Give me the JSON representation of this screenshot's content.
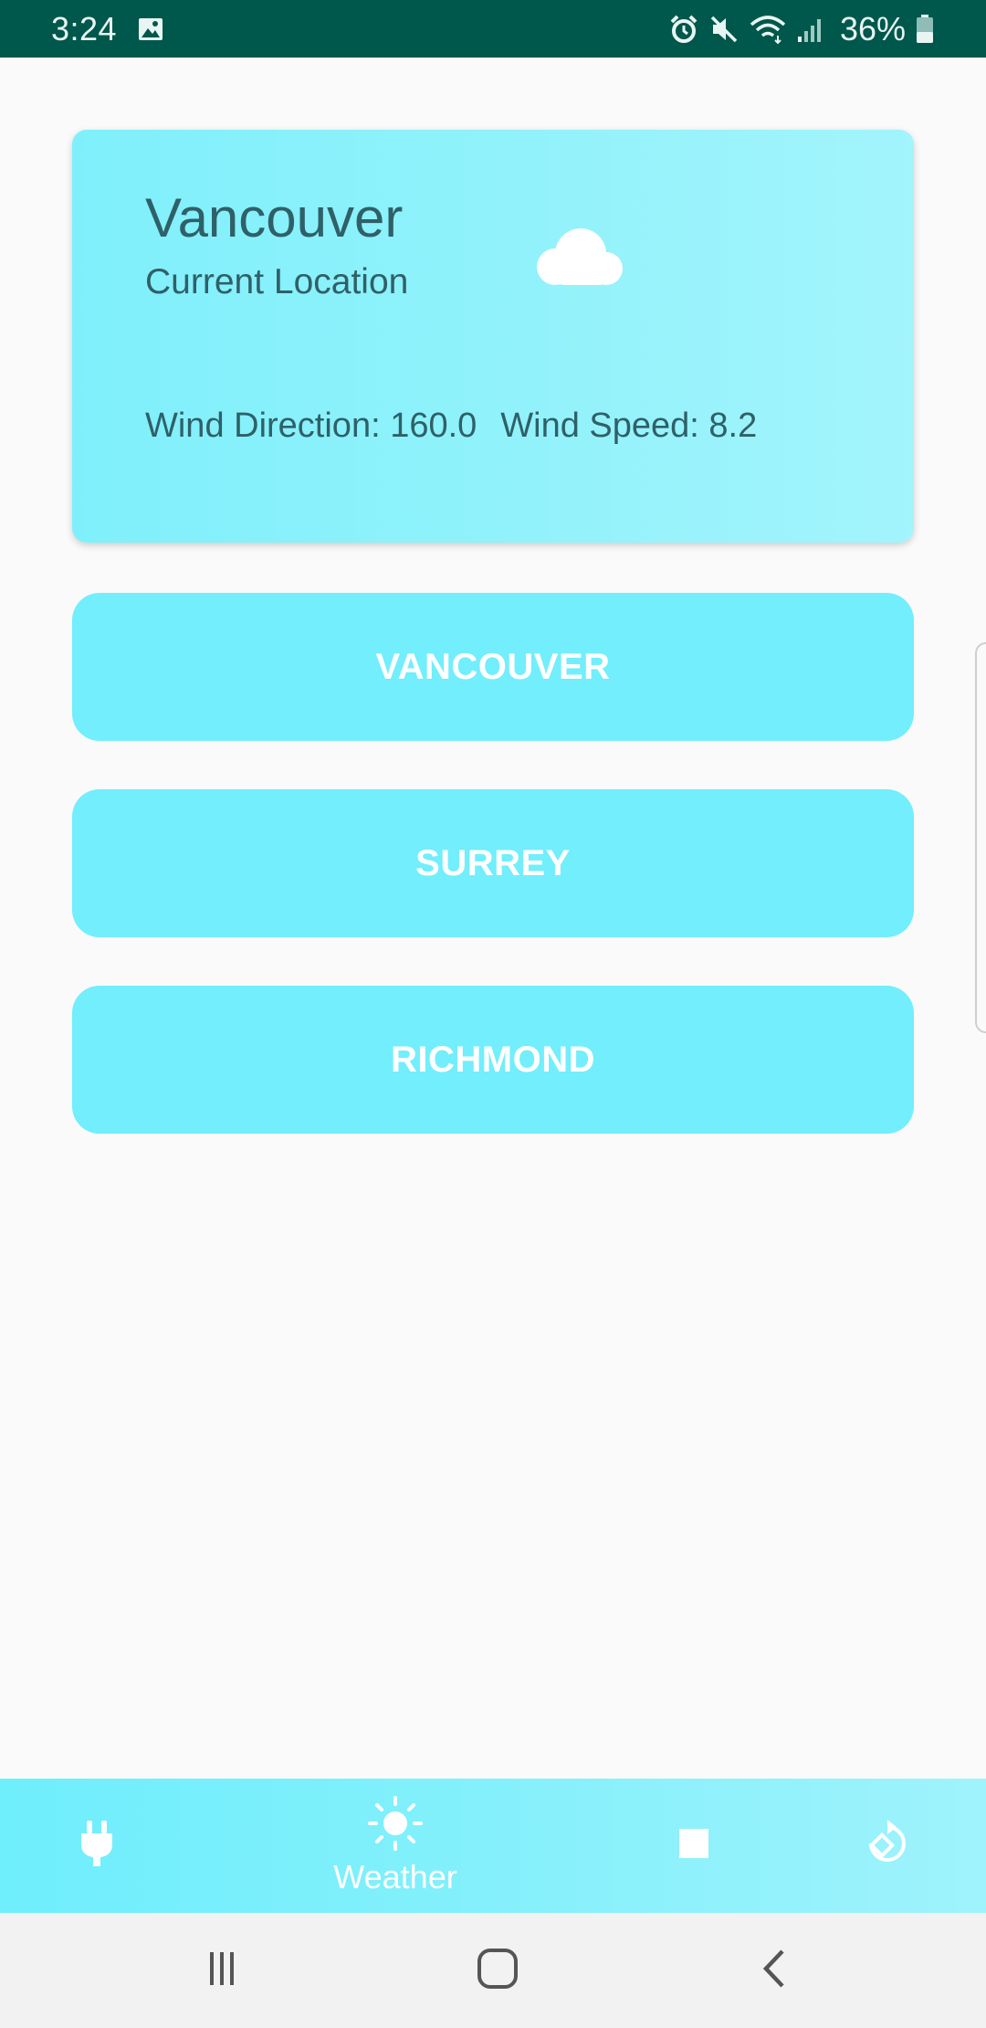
{
  "status_bar": {
    "time": "3:24",
    "battery": "36%",
    "background": "#00574b"
  },
  "weather_card": {
    "city": "Vancouver",
    "location_label": "Current Location",
    "condition_icon": "cloud-icon",
    "wind_direction": "Wind Direction: 160.0",
    "wind_speed": "Wind Speed: 8.2"
  },
  "city_buttons": [
    {
      "label": "VANCOUVER"
    },
    {
      "label": "SURREY"
    },
    {
      "label": "RICHMOND"
    }
  ],
  "bottom_nav": {
    "items": [
      {
        "icon": "plug-icon",
        "label": ""
      },
      {
        "icon": "sun-icon",
        "label": "Weather"
      },
      {
        "icon": "stop-icon",
        "label": ""
      },
      {
        "icon": "screen-rotate-icon",
        "label": ""
      }
    ],
    "accent": "#72eefc"
  },
  "system_nav": {
    "recent_icon": "recent-apps-icon",
    "home_icon": "home-icon",
    "back_icon": "back-icon"
  },
  "colors": {
    "button": "#72eefc",
    "card_text": "#2f6068",
    "background": "#fafafa"
  }
}
